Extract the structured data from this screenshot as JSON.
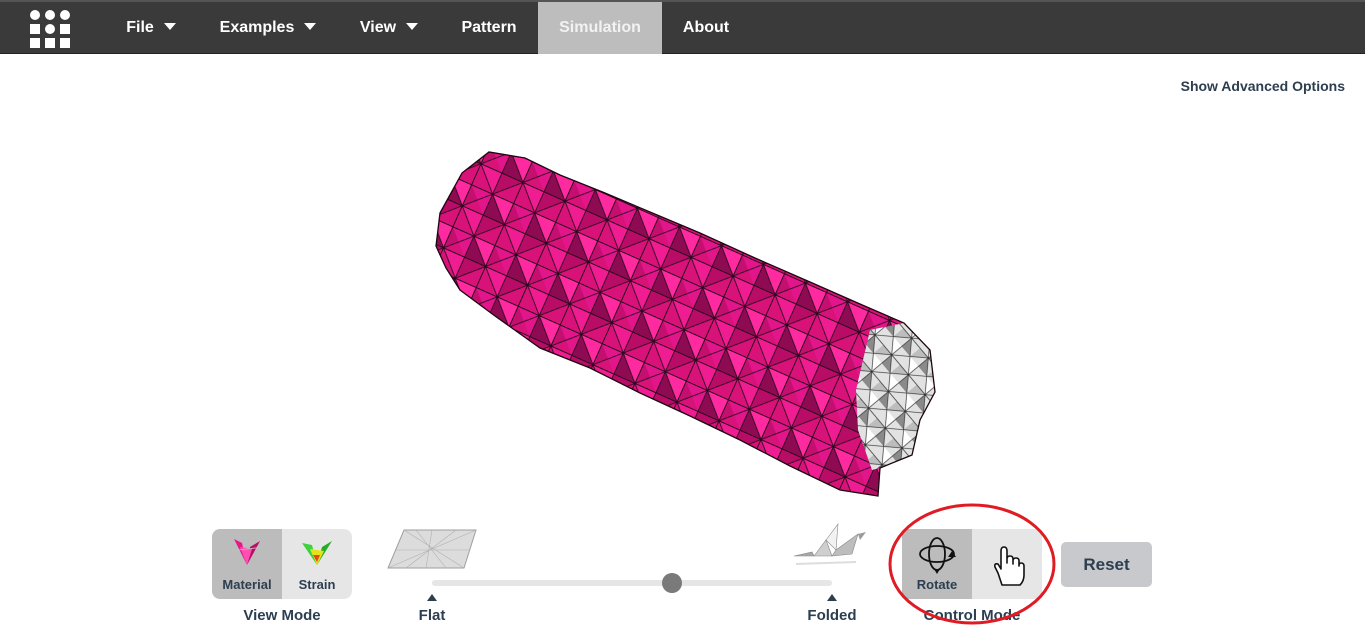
{
  "nav": {
    "logo_icon": "grid-logo-icon",
    "items": [
      {
        "label": "File",
        "has_dropdown": true
      },
      {
        "label": "Examples",
        "has_dropdown": true
      },
      {
        "label": "View",
        "has_dropdown": true
      },
      {
        "label": "Pattern",
        "has_dropdown": false
      },
      {
        "label": "Simulation",
        "has_dropdown": false,
        "active": true
      },
      {
        "label": "About",
        "has_dropdown": false
      }
    ]
  },
  "advanced_options_label": "Show Advanced Options",
  "view_mode": {
    "caption": "View Mode",
    "material_label": "Material",
    "strain_label": "Strain",
    "selected": "Material"
  },
  "fold_slider": {
    "flat_label": "Flat",
    "folded_label": "Folded",
    "value_fraction": 0.6
  },
  "control_mode": {
    "caption": "Control Mode",
    "rotate_label": "Rotate",
    "selected": "Rotate"
  },
  "reset_label": "Reset",
  "colors": {
    "nav_bg": "#3a3a3a",
    "active_tab": "#bdbdbd",
    "material_pink": "#e8168a",
    "annotation_red": "#e01b24",
    "text_dark": "#2c3e50"
  }
}
